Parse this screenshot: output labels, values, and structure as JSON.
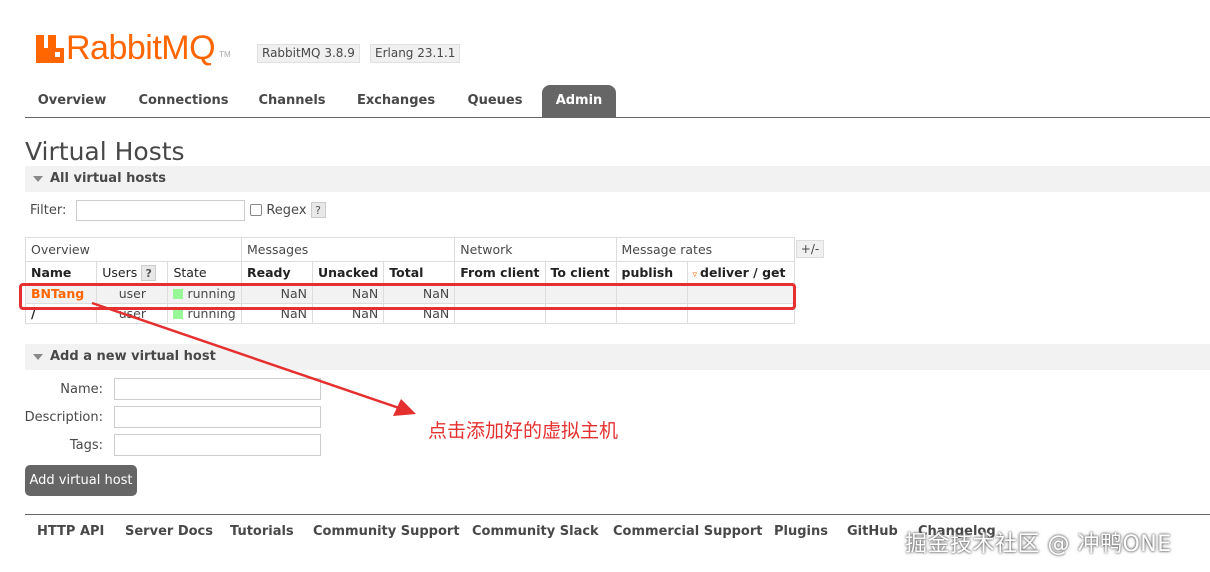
{
  "header": {
    "logo_text": "RabbitMQ",
    "logo_tm": "TM",
    "version_rabbit": "RabbitMQ 3.8.9",
    "version_erlang": "Erlang 23.1.1"
  },
  "tabs": [
    "Overview",
    "Connections",
    "Channels",
    "Exchanges",
    "Queues",
    "Admin"
  ],
  "active_tab": "Admin",
  "page": {
    "title": "Virtual Hosts",
    "section_all": "All virtual hosts",
    "filter_label": "Filter:",
    "filter_value": "",
    "regex_label": "Regex",
    "help_glyph": "?",
    "plus_minus": "+/-"
  },
  "table": {
    "groups": [
      "Overview",
      "Messages",
      "Network",
      "Message rates"
    ],
    "columns": [
      "Name",
      "Users",
      "State",
      "Ready",
      "Unacked",
      "Total",
      "From client",
      "To client",
      "publish",
      "deliver / get"
    ],
    "users_help": "?",
    "rows": [
      {
        "name": "BNTang",
        "users": "user",
        "state": "running",
        "ready": "NaN",
        "unacked": "NaN",
        "total": "NaN",
        "from_client": "",
        "to_client": "",
        "publish": "",
        "deliver_get": ""
      },
      {
        "name": "/",
        "users": "user",
        "state": "running",
        "ready": "NaN",
        "unacked": "NaN",
        "total": "NaN",
        "from_client": "",
        "to_client": "",
        "publish": "",
        "deliver_get": ""
      }
    ]
  },
  "add_section": {
    "title": "Add a new virtual host",
    "name_label": "Name:",
    "description_label": "Description:",
    "tags_label": "Tags:",
    "name_value": "",
    "description_value": "",
    "tags_value": "",
    "button_label": "Add virtual host"
  },
  "footer": [
    "HTTP API",
    "Server Docs",
    "Tutorials",
    "Community Support",
    "Community Slack",
    "Commercial Support",
    "Plugins",
    "GitHub",
    "Changelog"
  ],
  "annotation": "点击添加好的虚拟主机",
  "watermark": "掘金技术社区 @ 冲鸭ONE",
  "colors": {
    "brand": "#ff6600",
    "tab_active": "#666666",
    "running": "#98f898",
    "annotation": "#e53030"
  }
}
